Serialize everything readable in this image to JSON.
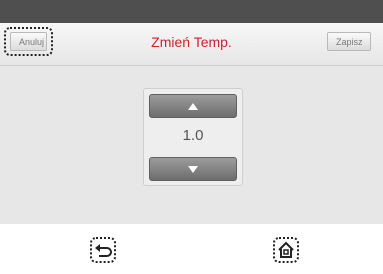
{
  "header": {
    "cancel_label": "Anuluj",
    "title": "Zmień Temp.",
    "save_label": "Zapisz"
  },
  "stepper": {
    "value": "1.0"
  },
  "nav": {
    "back_icon": "back-arrow-icon",
    "home_icon": "home-icon"
  },
  "colors": {
    "title": "#d1202e",
    "top_bar": "#4f4f4f",
    "content_bg": "#e7e7e7"
  }
}
